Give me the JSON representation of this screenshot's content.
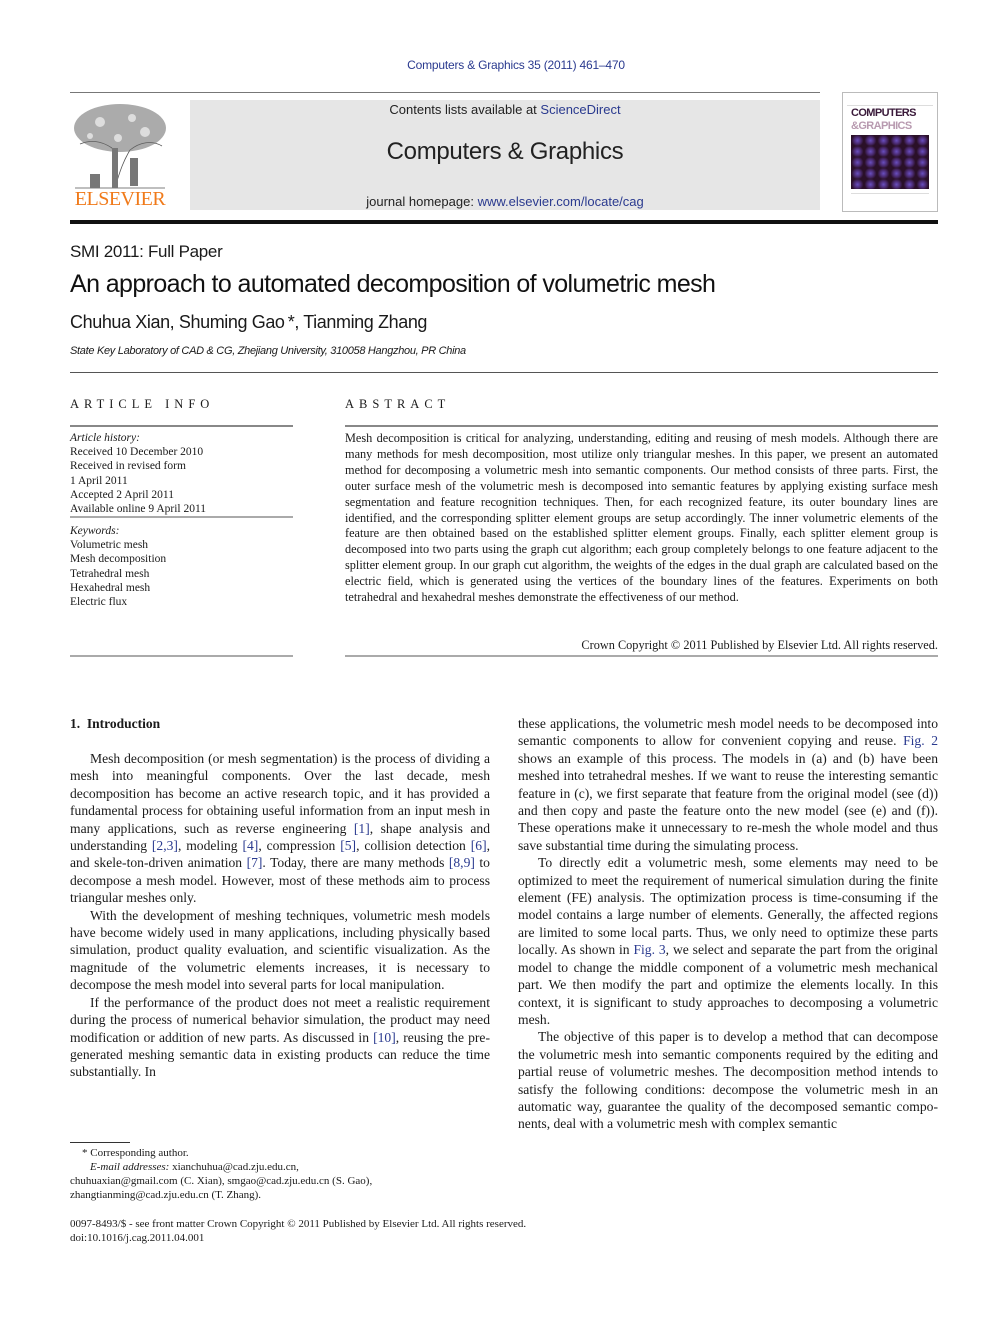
{
  "journal_citation": "Computers & Graphics 35 (2011) 461–470",
  "header": {
    "publisher_logo_text": "ELSEVIER",
    "contents_prefix": "Contents lists available at ",
    "contents_link": "ScienceDirect",
    "journal_title": "Computers & Graphics",
    "homepage_prefix": "journal homepage: ",
    "homepage_link": "www.elsevier.com/locate/cag",
    "cover_title_line1": "COMPUTERS",
    "cover_title_line2": "&GRAPHICS"
  },
  "colors": {
    "link": "#2a3a8f",
    "elsevier_orange": "#f07a1a",
    "banner_bg": "#e6e6e6"
  },
  "article": {
    "section_kind": "SMI 2011: Full Paper",
    "title": "An approach to automated decomposition of volumetric mesh",
    "authors": "Chuhua Xian, Shuming Gao *, Tianming Zhang",
    "affiliation": "State Key Laboratory of CAD & CG, Zhejiang University, 310058 Hangzhou, PR China"
  },
  "article_info": {
    "heading": "ARTICLE INFO",
    "history_label": "Article history:",
    "history": [
      "Received 10 December 2010",
      "Received in revised form",
      "1 April 2011",
      "Accepted 2 April 2011",
      "Available online 9 April 2011"
    ],
    "keywords_label": "Keywords:",
    "keywords": [
      "Volumetric mesh",
      "Mesh decomposition",
      "Tetrahedral mesh",
      "Hexahedral mesh",
      "Electric flux"
    ]
  },
  "abstract": {
    "heading": "ABSTRACT",
    "text": "Mesh decomposition is critical for analyzing, understanding, editing and reusing of mesh models. Although there are many methods for mesh decomposition, most utilize only triangular meshes. In this paper, we present an automated method for decomposing a volumetric mesh into semantic components. Our method consists of three parts. First, the outer surface mesh of the volumetric mesh is decomposed into semantic features by applying existing surface mesh segmentation and feature recognition techniques. Then, for each recognized feature, its outer boundary lines are identified, and the corresponding splitter element groups are setup accordingly. The inner volumetric elements of the feature are then obtained based on the established splitter element groups. Finally, each splitter element group is decomposed into two parts using the graph cut algorithm; each group completely belongs to one feature adjacent to the splitter element group. In our graph cut algorithm, the weights of the edges in the dual graph are calculated based on the electric field, which is generated using the vertices of the boundary lines of the features. Experiments on both tetrahedral and hexahedral meshes demonstrate the effectiveness of our method.",
    "copyright": "Crown Copyright © 2011 Published by Elsevier Ltd. All rights reserved."
  },
  "introduction": {
    "heading": "1. Introduction",
    "p1": {
      "t1": "Mesh decomposition (or mesh segmentation) is the process of dividing a mesh into meaningful components. Over the last decade, mesh decomposition has become an active research topic, and it has provided a fundamental process for obtaining useful information from an input mesh in many applications, such as reverse engineering ",
      "r1": "[1]",
      "t2": ", shape analysis and understanding ",
      "r2": "[2,3]",
      "t3": ", modeling ",
      "r3": "[4]",
      "t4": ", compression ",
      "r4": "[5]",
      "t5": ", collision detection ",
      "r5": "[6]",
      "t6": ", and skele-ton-driven animation ",
      "r6": "[7]",
      "t7": ". Today, there are many methods ",
      "r7": "[8,9]",
      "t8": " to decompose a mesh model. However, most of these methods aim to process triangular meshes only."
    },
    "p2": "With the development of meshing techniques, volumetric mesh models have become widely used in many applications, including physically based simulation, product quality evaluation, and scientific visualization. As the magnitude of the volumetric elements increases, it is necessary to decompose the mesh model into several parts for local manipulation.",
    "p3": {
      "t1": "If the performance of the product does not meet a realistic requirement during the process of numerical behavior simulation, the product may need modification or addition of new parts. As discussed in ",
      "r1": "[10]",
      "t2": ", reusing the pre-generated meshing semantic data in existing products can reduce the time substantially. In"
    },
    "p3_cont": {
      "t1": "these applications, the volumetric mesh model needs to be decomposed into semantic components to allow for convenient copying and reuse. ",
      "r1": "Fig. 2",
      "t2": " shows an example of this process. The models in (a) and (b) have been meshed into tetrahedral meshes. If we want to reuse the interesting semantic feature in (c), we first separate that feature from the original model (see (d)) and then copy and paste the feature onto the new model (see (e) and (f)). These operations make it unnecessary to re-mesh the whole model and thus save substantial time during the simulating process."
    },
    "p4": {
      "t1": "To directly edit a volumetric mesh, some elements may need to be optimized to meet the requirement of numerical simulation during the finite element (FE) analysis. The optimization process is time-consuming if the model contains a large number of elements. Generally, the affected regions are limited to some local parts. Thus, we only need to optimize these parts locally. As shown in ",
      "r1": "Fig. 3",
      "t2": ", we select and separate the part from the original model to change the middle component of a volumetric mesh mechanical part. We then modify the part and optimize the elements locally. In this context, it is significant to study approaches to decomposing a volumetric mesh."
    },
    "p5": "The objective of this paper is to develop a method that can decompose the volumetric mesh into semantic components required by the editing and partial reuse of volumetric meshes. The decomposition method intends to satisfy the following conditions: decompose the volumetric mesh in an automatic way, guarantee the quality of the decomposed semantic compo-nents, deal with a volumetric mesh with complex semantic"
  },
  "footnote": {
    "corresponding": "* Corresponding author.",
    "email_label": "E-mail addresses:",
    "email_line1": " xianchuhua@cad.zju.edu.cn,",
    "email_line2": "chuhuaxian@gmail.com (C. Xian), smgao@cad.zju.edu.cn (S. Gao),",
    "email_line3": "zhangtianming@cad.zju.edu.cn (T. Zhang)."
  },
  "front_matter": {
    "issn_line": "0097-8493/$ - see front matter Crown Copyright © 2011 Published by Elsevier Ltd. All rights reserved.",
    "doi": "doi:10.1016/j.cag.2011.04.001"
  }
}
